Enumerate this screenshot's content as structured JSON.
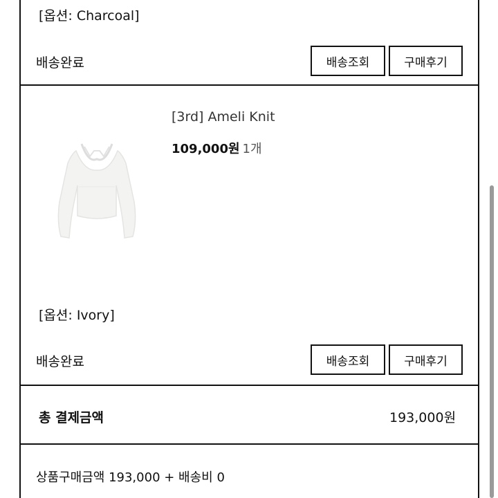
{
  "first_item": {
    "option": "[옵션: Charcoal]",
    "status": "배송완료",
    "track_button": "배송조회",
    "review_button": "구매후기"
  },
  "second_item": {
    "title": "[3rd] Ameli Knit",
    "price": "109,000원",
    "quantity": "1개",
    "option": "[옵션: Ivory]",
    "status": "배송완료",
    "track_button": "배송조회",
    "review_button": "구매후기"
  },
  "total": {
    "label": "총 결제금액",
    "value": "193,000원"
  },
  "breakdown": "상품구매금액 193,000 + 배송비 0",
  "product_image_icon": "ivory-knit-top-image"
}
